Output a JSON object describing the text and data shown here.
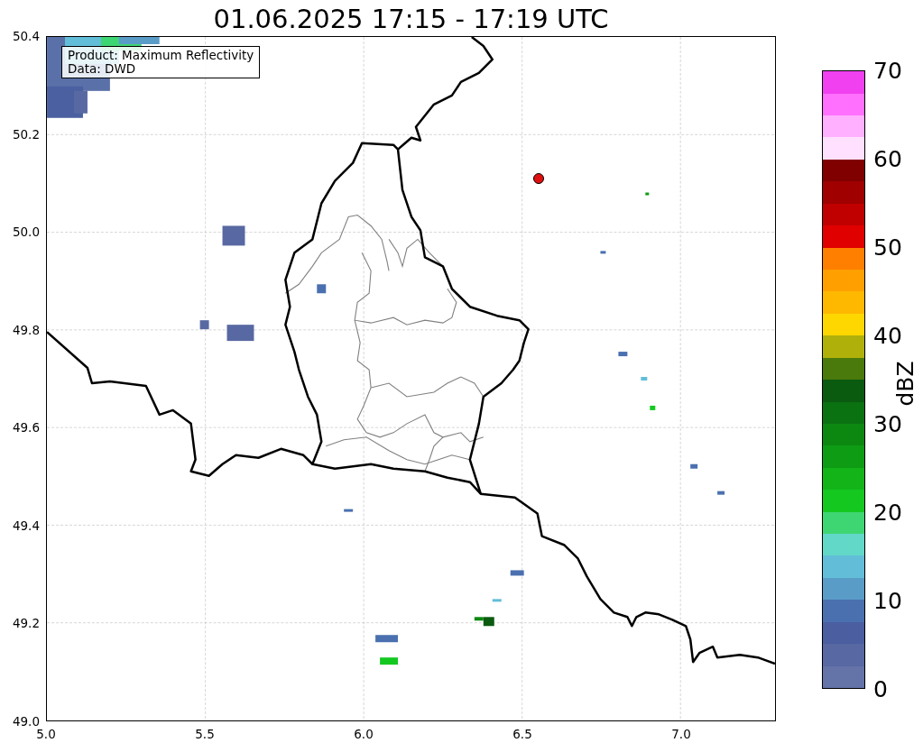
{
  "title": "01.06.2025 17:15 - 17:19 UTC",
  "legend": [
    "Product: Maximum Reflectivity",
    "Data: DWD"
  ],
  "x_ticks": [
    "5.0",
    "5.5",
    "6.0",
    "6.5",
    "7.0"
  ],
  "y_ticks": [
    "50.4",
    "50.2",
    "50.0",
    "49.8",
    "49.6",
    "49.4",
    "49.2",
    "49.0"
  ],
  "colorbar": {
    "label": "dBZ",
    "ticks": [
      "70",
      "60",
      "50",
      "40",
      "30",
      "20",
      "10",
      "0"
    ],
    "bins": [
      {
        "color": "#6473a8"
      },
      {
        "color": "#5868a2"
      },
      {
        "color": "#4a5ea0"
      },
      {
        "color": "#4a70b0"
      },
      {
        "color": "#5a9cc8"
      },
      {
        "color": "#62bed8"
      },
      {
        "color": "#62d8c8"
      },
      {
        "color": "#3ed672"
      },
      {
        "color": "#14c820"
      },
      {
        "color": "#12b418"
      },
      {
        "color": "#0e9c14"
      },
      {
        "color": "#0c8810"
      },
      {
        "color": "#0b7212"
      },
      {
        "color": "#0a5a10"
      },
      {
        "color": "#4a7a0c"
      },
      {
        "color": "#b0b00a"
      },
      {
        "color": "#ffd700"
      },
      {
        "color": "#ffb800"
      },
      {
        "color": "#ffa000"
      },
      {
        "color": "#ff8000"
      },
      {
        "color": "#e00000"
      },
      {
        "color": "#c00000"
      },
      {
        "color": "#a00000"
      },
      {
        "color": "#800000"
      },
      {
        "color": "#ffe0ff"
      },
      {
        "color": "#ffb0ff"
      },
      {
        "color": "#ff70ff"
      },
      {
        "color": "#f040f0"
      }
    ]
  }
}
